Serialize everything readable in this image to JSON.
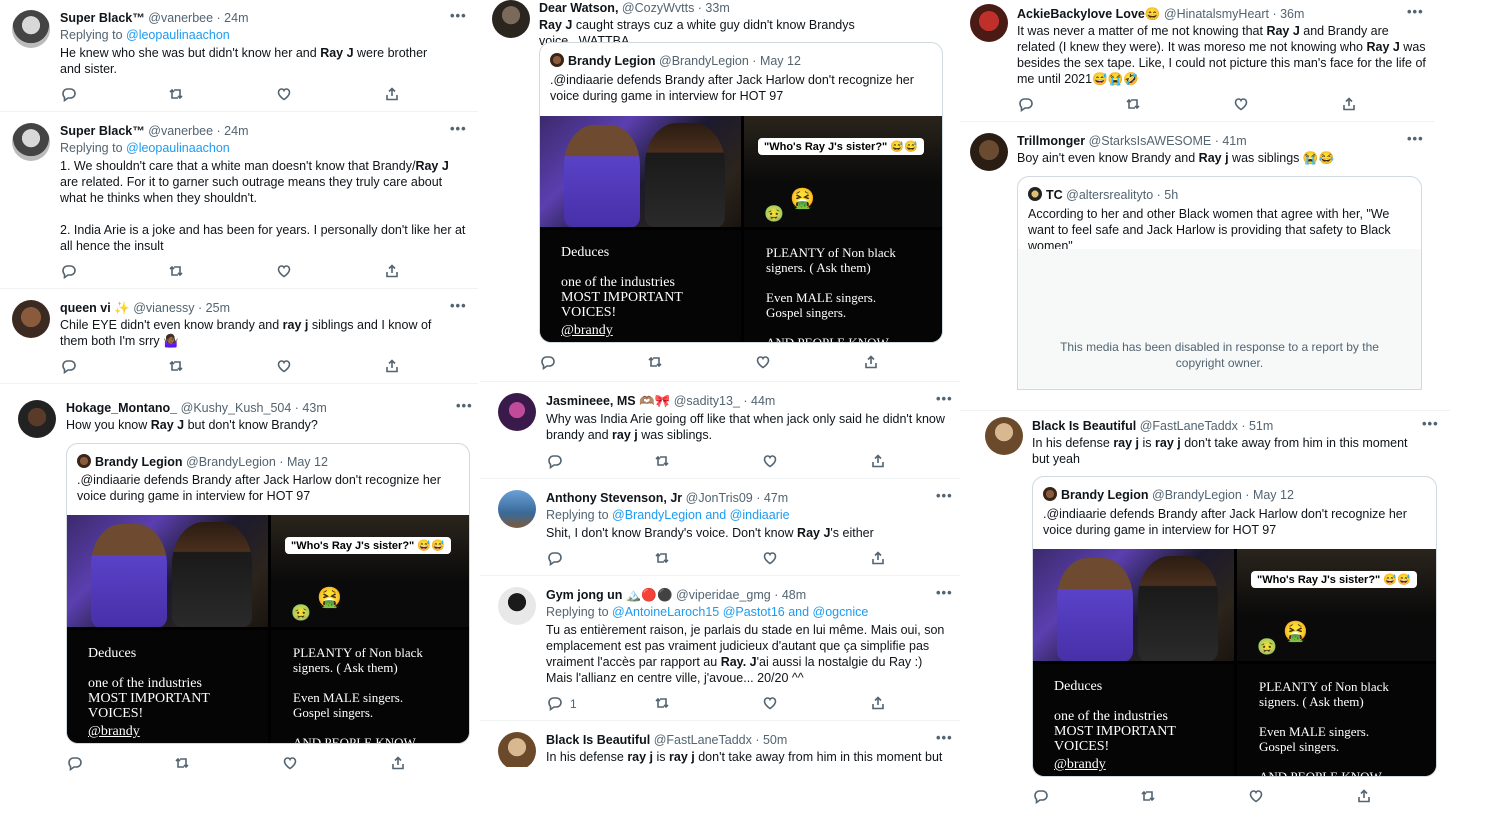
{
  "icons": {
    "reply": "reply-icon",
    "retweet": "retweet-icon",
    "like": "like-icon",
    "share": "share-icon",
    "more": "more-icon"
  },
  "colors": {
    "link": "#1d9bf0",
    "muted": "#536471",
    "text": "#0f1419",
    "border": "#cfd9de"
  },
  "more_label": "•••",
  "quote_brandy": {
    "name": "Brandy Legion",
    "handle_time": "@BrandyLegion · May 12",
    "text": ".@indiaarie defends Brandy after Jack Harlow don't recognize her voice during game in interview for HOT 97",
    "caption": "\"Who's Ray J's sister?\" 😅😅",
    "left_text": "Deduces\n\none of  the industries\nMOST IMPORTANT\nVOICES!",
    "left_link": "@brandy",
    "right_text": "PLEANTY of Non black\nsigners.  ( Ask them)\n\nEven MALE singers.\nGospel singers.\n\nAND PEOPLE KNOW"
  },
  "col1": [
    {
      "name": "Super Black™",
      "handle_time": "@vanerbee · 24m",
      "replying_prefix": "Replying to ",
      "replying_to": "@leopaulinaachon",
      "text_a": "He knew who she was but didn't know her and ",
      "text_b": "Ray J",
      "text_c": " were brother and sister."
    },
    {
      "name": "Super Black™",
      "handle_time": "@vanerbee · 24m",
      "replying_prefix": "Replying to ",
      "replying_to": "@leopaulinaachon",
      "text_a": "1. We shouldn't care that a white man doesn't know that Brandy/",
      "text_b": "Ray J",
      "text_c": " are related. For it to garner such outrage means they truly care about what he thinks when they shouldn't.\n\n2. India Arie is a joke and has been for years. I personally don't like her at all hence the insult"
    },
    {
      "name": "queen vi ✨",
      "handle_time": "@vianessy · 25m",
      "text_a": "Chile EYE didn't even know brandy and ",
      "text_b": "ray j",
      "text_c": " siblings and I know of them both I'm srry 🤷🏾‍♀️"
    },
    {
      "name": "Hokage_Montano_",
      "handle_time": "@Kushy_Kush_504 · 43m",
      "text_a": "How you know ",
      "text_b": "Ray J",
      "text_c": " but don't know Brandy?"
    }
  ],
  "col2": [
    {
      "name": "Dear Watson,",
      "handle_time": "@CozyWvtts · 33m",
      "text_a": "",
      "text_b": "Ray J",
      "text_c": " caught strays cuz a white guy didn't know Brandys voice...WATTBA"
    },
    {
      "name": "Jasmineee, MS 🫶🏽🎀",
      "handle_time": "@sadity13_ · 44m",
      "text_a": "Why was India Arie going off like that when jack only said he didn't know brandy and ",
      "text_b": "ray j",
      "text_c": " was siblings."
    },
    {
      "name": "Anthony Stevenson, Jr",
      "handle_time": "@JonTris09 · 47m",
      "replying_prefix": "Replying to ",
      "replying_to": "@BrandyLegion and @indiaarie",
      "text_a": "Shit, I don't know Brandy's voice. Don't know ",
      "text_b": "Ray J",
      "text_c": "'s either"
    },
    {
      "name": "Gym jong un 🏔️🔴⚫",
      "handle_time": "@viperidae_gmg · 48m",
      "replying_prefix": "Replying to ",
      "replying_to": "@AntoineLaroch15 @Pastot16 and @ogcnice",
      "text_a": "Tu as entièrement raison, je parlais du stade en lui même. Mais oui, son emplacement est pas vraiment judicieux d'autant que ça simplifie pas vraiment l'accès par rapport au ",
      "text_b": "Ray. J",
      "text_c": "'ai aussi la nostalgie du Ray :)\nMais l'allianz en centre ville, j'avoue... 20/20 ^^",
      "reply_count": "1"
    },
    {
      "name": "Black Is Beautiful",
      "handle_time": "@FastLaneTaddx · 50m",
      "text_a": "In his defense ",
      "text_b": "ray j",
      "text_mid": " is ",
      "text_d": "ray j",
      "text_c": " don't take away from him in this moment but"
    }
  ],
  "col3": [
    {
      "name": "AckieBackylove Love😄",
      "handle_time": "@HinatalsmyHeart · 36m",
      "text_a": "It was never a matter of me not knowing that ",
      "text_b": "Ray J",
      "text_c": " and Brandy are related (I knew they were). It was moreso me not knowing who ",
      "text_d": "Ray J",
      "text_e": " was besides the sex tape. Like, I could not picture this man's face for the life of me until 2021😅😭🤣"
    },
    {
      "name": "Trillmonger",
      "handle_time": "@StarksIsAWESOME · 41m",
      "text_a": "Boy ain't even know Brandy and ",
      "text_b": "Ray j",
      "text_c": " was siblings 😭😂",
      "quote_name": "TC",
      "quote_handle_time": "@altersrealityto · 5h",
      "quote_text": "According to her and other Black women that agree with her, \"We want to feel safe and Jack Harlow is providing that safety to Black women\"",
      "quote_disabled": "This media has been disabled in response to a report by the copyright owner."
    },
    {
      "name": "Black Is Beautiful",
      "handle_time": "@FastLaneTaddx · 51m",
      "text_a": "In his defense ",
      "text_b": "ray j",
      "text_mid": " is ",
      "text_d": "ray j",
      "text_c": " don't take away from him in this moment but yeah"
    }
  ]
}
